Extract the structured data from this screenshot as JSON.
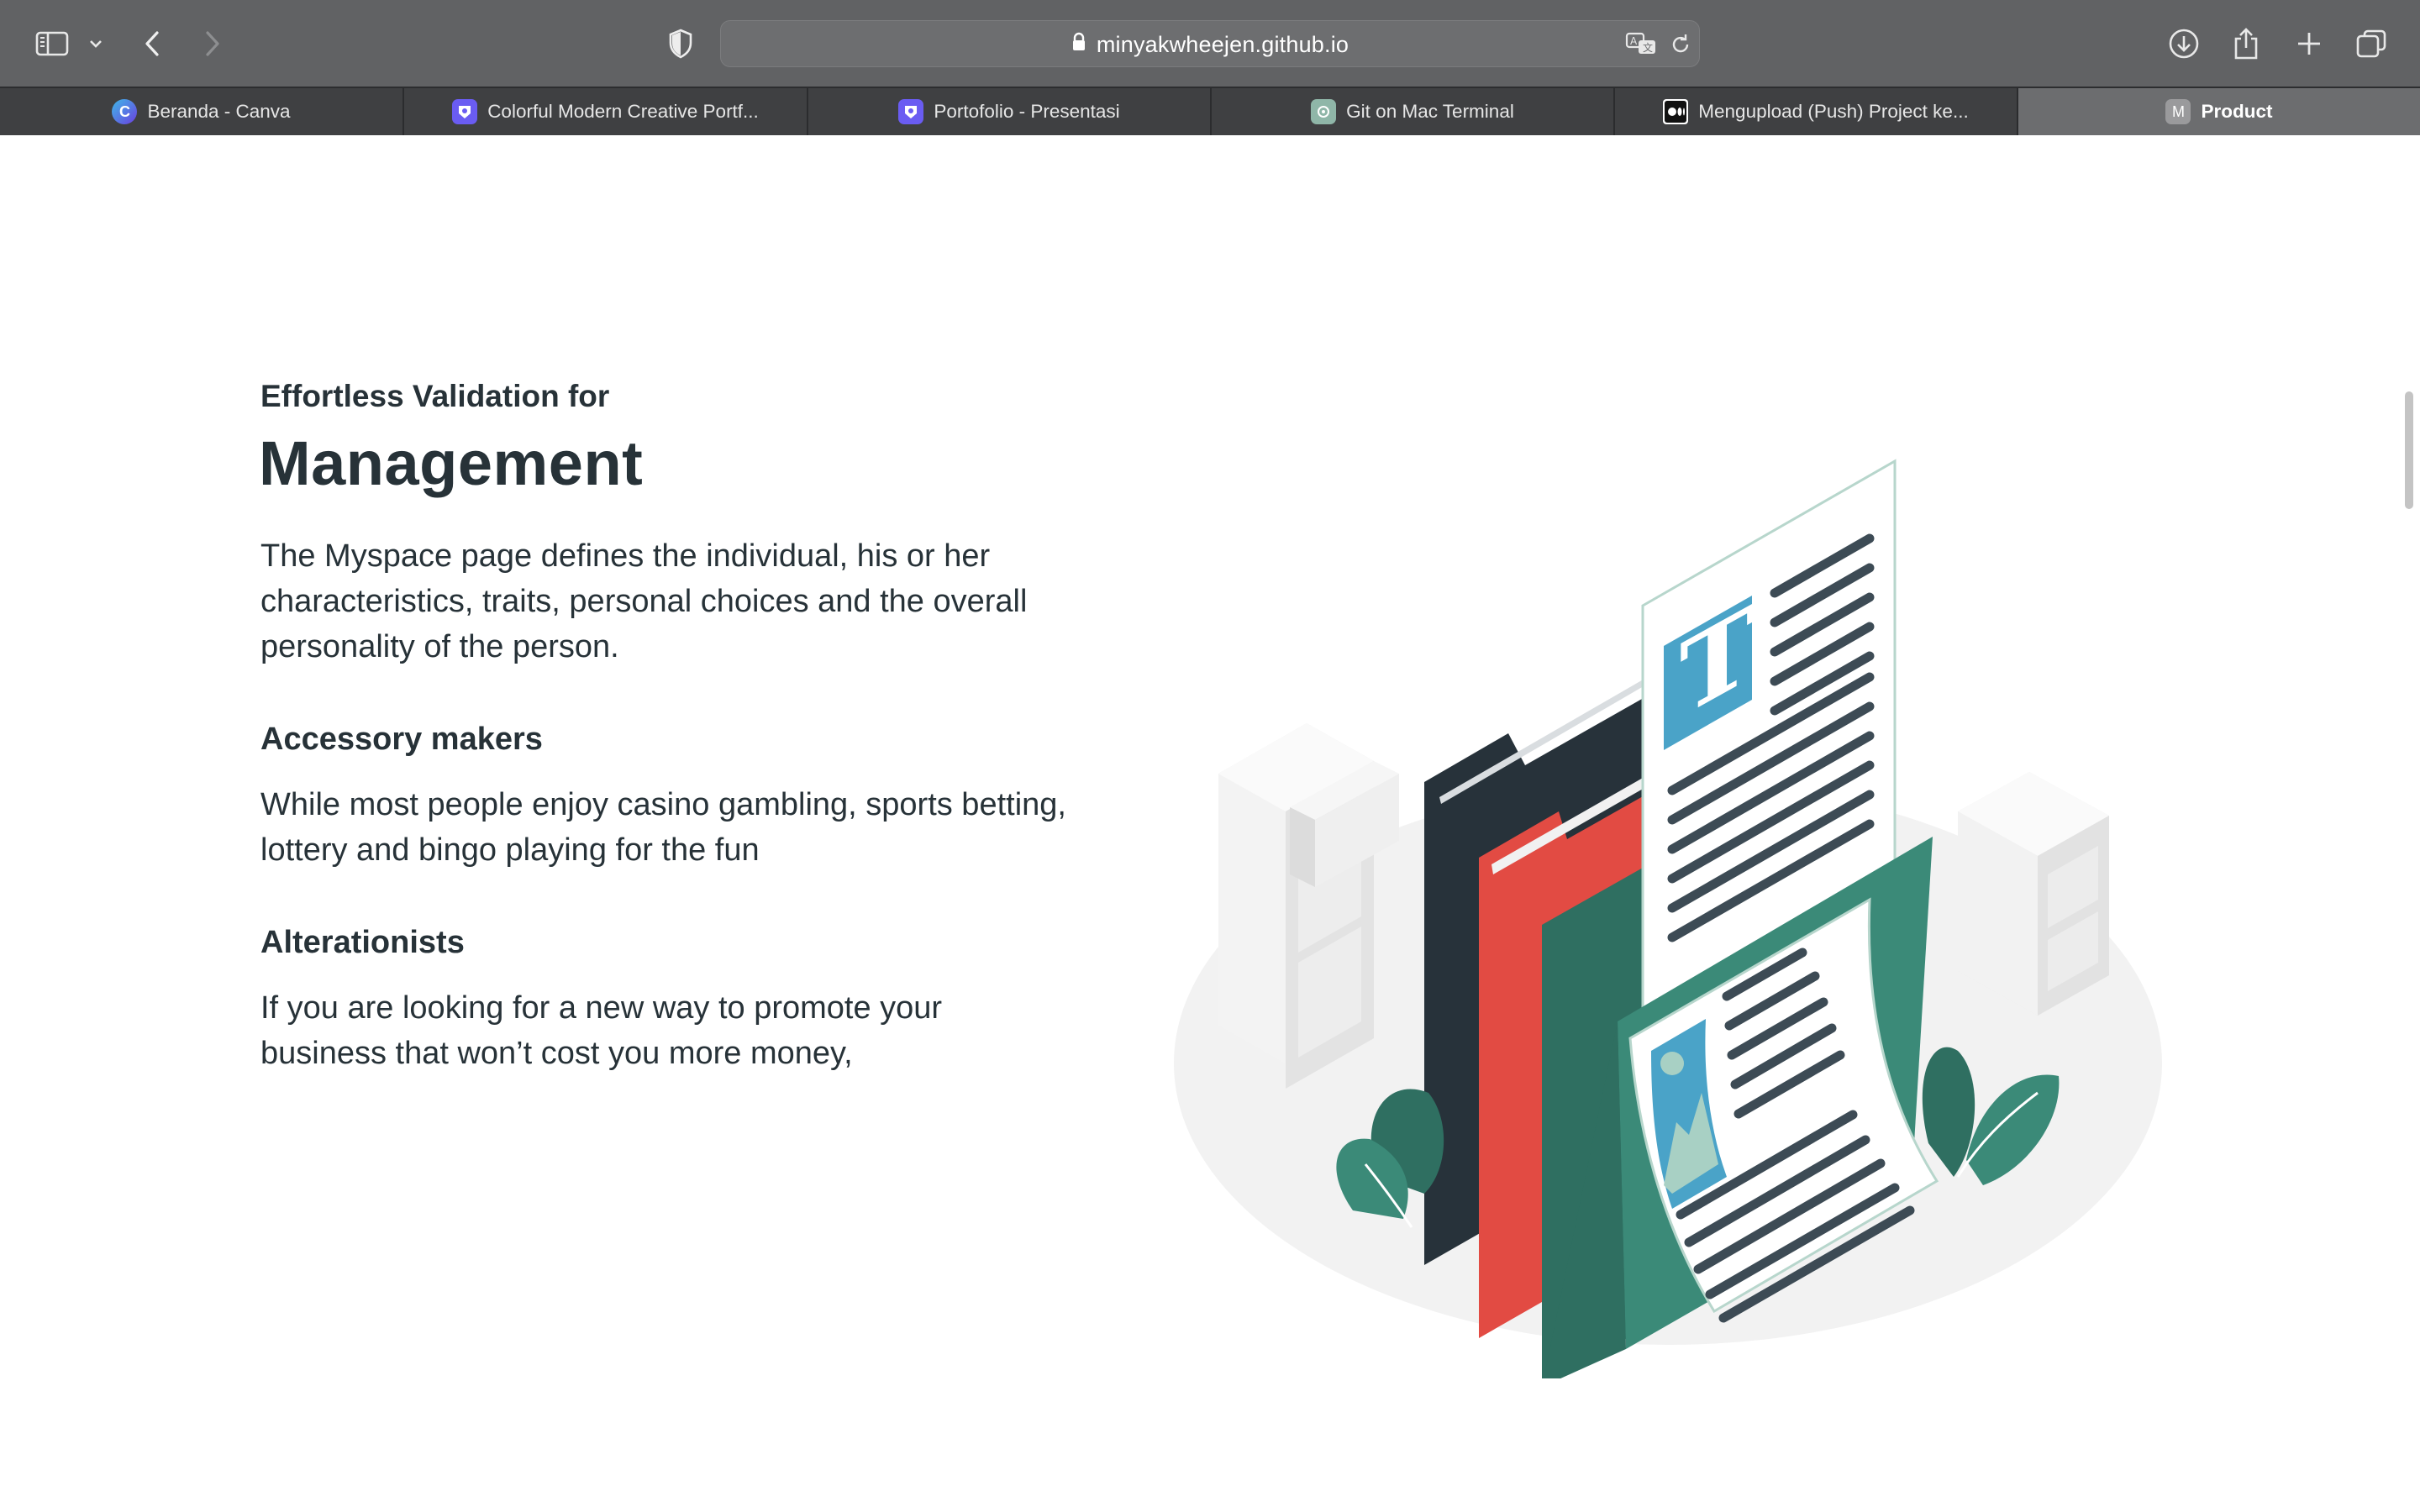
{
  "browser": {
    "url": "minyakwheejen.github.io",
    "icons": {
      "sidebar": "sidebar-icon",
      "sidebar_menu": "chevron-down-icon",
      "back": "back-arrow-icon",
      "forward": "forward-arrow-icon",
      "privacy": "shield-icon",
      "lock": "lock-icon",
      "translate": "translate-icon",
      "reload": "reload-icon",
      "download": "download-icon",
      "share": "share-icon",
      "new_tab": "plus-icon",
      "tab_overview": "tabs-overview-icon"
    }
  },
  "tabs": [
    {
      "label": "Beranda - Canva",
      "favicon_letter": "C",
      "favicon_color": "#5b4fe0",
      "active": false
    },
    {
      "label": "Colorful Modern Creative Portf...",
      "favicon_letter": "",
      "favicon_color": "#6a5cf2",
      "active": false
    },
    {
      "label": "Portofolio - Presentasi",
      "favicon_letter": "",
      "favicon_color": "#6a5cf2",
      "active": false
    },
    {
      "label": "Git on Mac Terminal",
      "favicon_letter": "",
      "favicon_color": "#8fb6a8",
      "active": false
    },
    {
      "label": "Mengupload (Push) Project ke...",
      "favicon_letter": "",
      "favicon_color": "#111111",
      "active": false
    },
    {
      "label": "Product",
      "favicon_letter": "M",
      "favicon_color": "#9a9a9c",
      "active": true
    }
  ],
  "page": {
    "subtitle": "Effortless Validation for",
    "title": "Management",
    "intro": "The Myspace page defines the individual, his or her characteristics, traits, personal choices and the overall personality of the person.",
    "features": [
      {
        "heading": "Accessory makers",
        "text": "While most people enjoy casino gambling, sports betting, lottery and bingo playing for the fun"
      },
      {
        "heading": "Alterationists",
        "text": "If you are looking for a new way to promote your business that won’t cost you more money,"
      }
    ],
    "illustration": "document-management-illustration"
  },
  "colors": {
    "text": "#273238",
    "teal": "#3b8a78",
    "red": "#e24b43",
    "navy": "#27323a",
    "blue": "#4aa3c8"
  }
}
